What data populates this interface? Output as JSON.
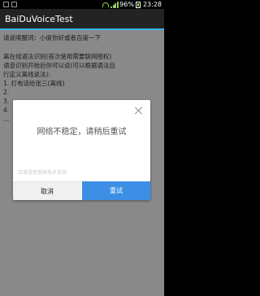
{
  "status_bar": {
    "battery_text": "96%",
    "time": "23:28"
  },
  "app": {
    "title": "BaiDuVoiceTest"
  },
  "content": {
    "wake_line": "请说唤醒词：小度你好或者百度一下",
    "offline_line1": "离在线语法识别(首次使用需要联网授权)",
    "offline_line2": "语音识别开始后你可以说(可以根据语法自",
    "offline_line3": "行定义离线说法):",
    "item1": "1. 打电话给张三(离线)",
    "item2": "2.",
    "item3": "3.",
    "item4": "4.",
    "ellipsis": "..."
  },
  "dialog": {
    "message": "网络不稳定，请稍后重试",
    "footer_hint": "百度语音提供技术支持",
    "cancel_label": "取消",
    "retry_label": "重试"
  },
  "colors": {
    "action_bar": "#232323",
    "accent": "#33b5e5",
    "retry_button": "#3d8fe6",
    "background": "#9c9c9c"
  }
}
